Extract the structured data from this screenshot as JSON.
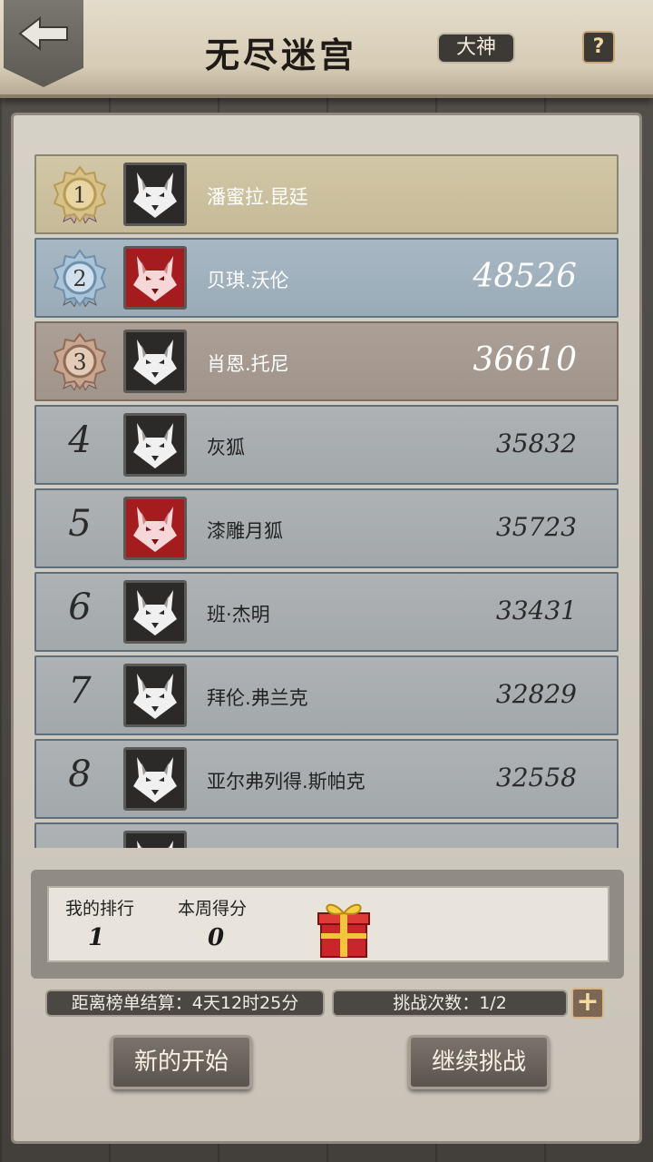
{
  "header": {
    "title": "无尽迷宫",
    "difficulty": "大神",
    "help": "?"
  },
  "leaderboard": [
    {
      "rank": "1",
      "tier": "gold",
      "avatar": "wolf-dark",
      "name": "潘蜜拉.昆廷",
      "score": ""
    },
    {
      "rank": "2",
      "tier": "silver",
      "avatar": "wolf-red",
      "name": "贝琪.沃伦",
      "score": "48526"
    },
    {
      "rank": "3",
      "tier": "bronze",
      "avatar": "wolf-dark",
      "name": "肖恩.托尼",
      "score": "36610"
    },
    {
      "rank": "4",
      "tier": "normal",
      "avatar": "wolf-dark",
      "name": "灰狐",
      "score": "35832"
    },
    {
      "rank": "5",
      "tier": "normal",
      "avatar": "wolf-red",
      "name": "漆雕月狐",
      "score": "35723"
    },
    {
      "rank": "6",
      "tier": "normal",
      "avatar": "wolf-dark",
      "name": "班·杰明",
      "score": "33431"
    },
    {
      "rank": "7",
      "tier": "normal",
      "avatar": "wolf-dark",
      "name": "拜伦.弗兰克",
      "score": "32829"
    },
    {
      "rank": "8",
      "tier": "normal",
      "avatar": "wolf-dark",
      "name": "亚尔弗列得.斯帕克",
      "score": "32558"
    },
    {
      "rank": "",
      "tier": "normal",
      "avatar": "wolf-dark",
      "name": "",
      "score": ""
    }
  ],
  "my_stats": {
    "rank_label": "我的排行",
    "rank_value": "1",
    "score_label": "本周得分",
    "score_value": "0"
  },
  "timer": {
    "settle_text": "距离榜单结算：4天12时25分",
    "challenge_text": "挑战次数：1/2"
  },
  "buttons": {
    "new_start": "新的开始",
    "continue": "继续挑战"
  },
  "icons": {
    "back": "back-arrow-icon",
    "gift": "gift-box-icon",
    "plus": "plus-icon"
  },
  "colors": {
    "gold_row": "#d2c7a6",
    "silver_row": "#a7b8c4",
    "bronze_row": "#aca096",
    "normal_row": "#aeb2b4"
  }
}
